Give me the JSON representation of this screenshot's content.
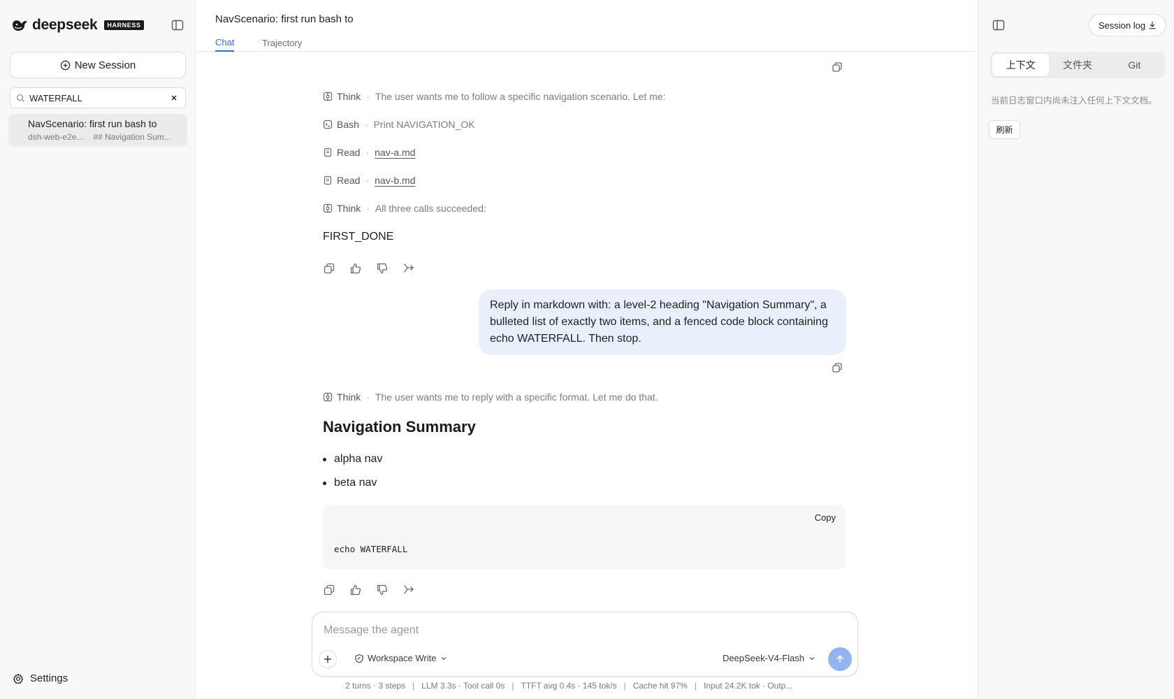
{
  "sidebar": {
    "brand": "deepseek",
    "badge": "HARNESS",
    "new_session_label": "New Session",
    "search": {
      "value": "WATERFALL",
      "placeholder": "Search"
    },
    "sessions": [
      {
        "title": "NavScenario: first run bash to",
        "id": "dsh-web-e2e...",
        "preview": "## Navigation Sum..."
      }
    ],
    "settings_label": "Settings"
  },
  "header": {
    "title": "NavScenario: first run bash to",
    "tabs": [
      {
        "label": "Chat",
        "active": true
      },
      {
        "label": "Trajectory",
        "active": false
      }
    ]
  },
  "chat": {
    "turn1": {
      "tools": [
        {
          "icon": "think-icon",
          "name": "Think",
          "desc": "The user wants me to follow a specific navigation scenario. Let me:"
        },
        {
          "icon": "terminal-icon",
          "name": "Bash",
          "desc": "Print NAVIGATION_OK"
        },
        {
          "icon": "file-icon",
          "name": "Read",
          "link": "nav-a.md"
        },
        {
          "icon": "file-icon",
          "name": "Read",
          "link": "nav-b.md"
        },
        {
          "icon": "think-icon",
          "name": "Think",
          "desc": "All three calls succeeded:"
        }
      ],
      "answer": "FIRST_DONE"
    },
    "user_message": "Reply in markdown with: a level-2 heading \"Navigation Summary\", a bulleted list of exactly two items, and a fenced code block containing echo WATERFALL. Then stop.",
    "turn2": {
      "think": {
        "name": "Think",
        "desc": "The user wants me to reply with a specific format. Let me do that."
      },
      "heading": "Navigation Summary",
      "bullets": [
        "alpha nav",
        "beta nav"
      ],
      "code": {
        "copy_label": "Copy",
        "content": "echo WATERFALL"
      }
    },
    "dot": "·"
  },
  "composer": {
    "placeholder": "Message the agent",
    "mode": "Workspace Write",
    "model": "DeepSeek-V4-Flash"
  },
  "status": {
    "turns": "2 turns · 3 steps",
    "llm": "LLM 3.3s · Tool call 0s",
    "ttft": "TTFT avg 0.4s · 145 tok/s",
    "cache": "Cache hit 97%",
    "tokens": "Input 24.2K tok · Outp...",
    "sep": "|"
  },
  "right_panel": {
    "session_log_label": "Session log",
    "tabs": [
      {
        "label": "上下文",
        "active": true
      },
      {
        "label": "文件夹",
        "active": false
      },
      {
        "label": "Git",
        "active": false
      }
    ],
    "empty_text": "当前日志窗口内尚未注入任何上下文文档。",
    "refresh_label": "刷新"
  },
  "colors": {
    "accent": "#2f6fcf",
    "user_bubble": "#e9effb",
    "send_button": "#93b4ef"
  }
}
